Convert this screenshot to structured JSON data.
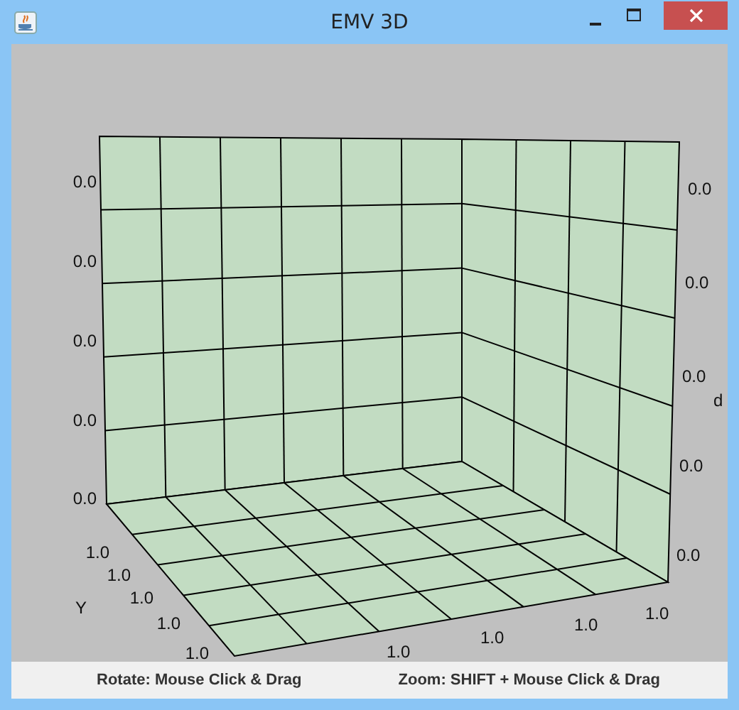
{
  "window": {
    "title": "EMV 3D"
  },
  "plot": {
    "left_axis_labels": [
      "0.0",
      "0.0",
      "0.0",
      "0.0",
      "0.0"
    ],
    "right_axis_labels": [
      "0.0",
      "0.0",
      "0.0",
      "0.0",
      "0.0"
    ],
    "right_axis_title": "d",
    "y_axis_labels": [
      "1.0",
      "1.0",
      "1.0",
      "1.0",
      "1.0"
    ],
    "y_axis_title": "Y",
    "x_axis_labels": [
      "1.0",
      "1.0",
      "1.0",
      "1.0"
    ]
  },
  "status_bar": [
    "Rotate: Mouse Click & Drag",
    "Zoom: SHIFT + Mouse Click & Drag"
  ]
}
